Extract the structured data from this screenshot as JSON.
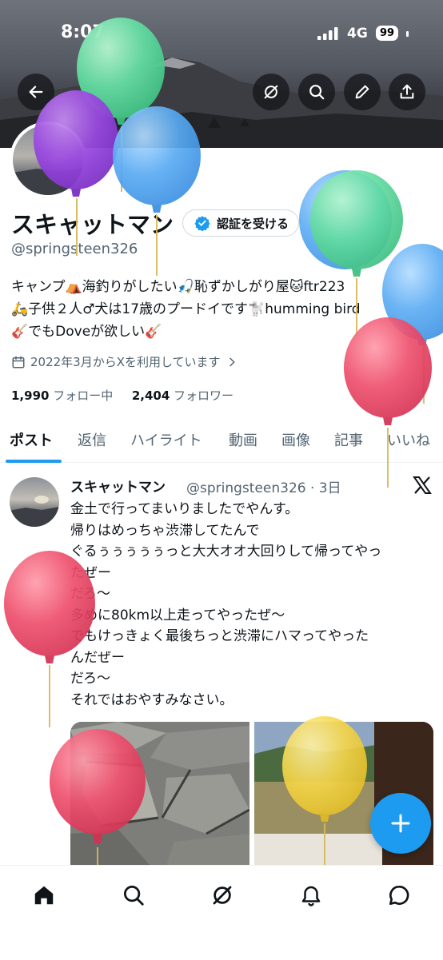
{
  "status_bar": {
    "time": "8:07",
    "network": "4G",
    "battery": "99"
  },
  "profile": {
    "display_name": "スキャットマン",
    "verify_label": "認証を受ける",
    "handle": "@springsteen326",
    "bio_lines": [
      "キャンプ⛺海釣りがしたい🎣恥ずかしがり屋🐱ftr223",
      "🛵子供２人♂犬は17歳のプードイです🐩humming bird",
      "🎸でもDoveが欲しい🎸"
    ],
    "joined": "2022年3月からXを利用しています",
    "following_count": "1,990",
    "following_label": "フォロー中",
    "followers_count": "2,404",
    "followers_label": "フォロワー"
  },
  "tabs": [
    "ポスト",
    "返信",
    "ハイライト",
    "動画",
    "画像",
    "記事",
    "いいね"
  ],
  "post": {
    "author": "スキャットマン",
    "handle_time": "@springsteen326 · 3日",
    "lines": [
      "金土で行ってまいりましたでやんす。",
      "帰りはめっちゃ渋滞してたんで",
      "ぐるぅぅぅぅぅっと大大オオ大回りして帰ってやっ",
      "たぜー",
      "だろ〜",
      "多めに80km以上走ってやったぜ〜",
      "でもけっきょく最後ちっと渋滞にハマってやった",
      "んだぜー",
      "だろ〜",
      "それではおやすみなさい。"
    ]
  },
  "fab_icon": "plus-icon",
  "nav_icons": [
    "home-icon",
    "search-icon",
    "grok-icon",
    "notifications-icon",
    "messages-icon"
  ],
  "colors": {
    "accent": "#1d9bf0",
    "text": "#0f1419",
    "muted": "#536471"
  }
}
